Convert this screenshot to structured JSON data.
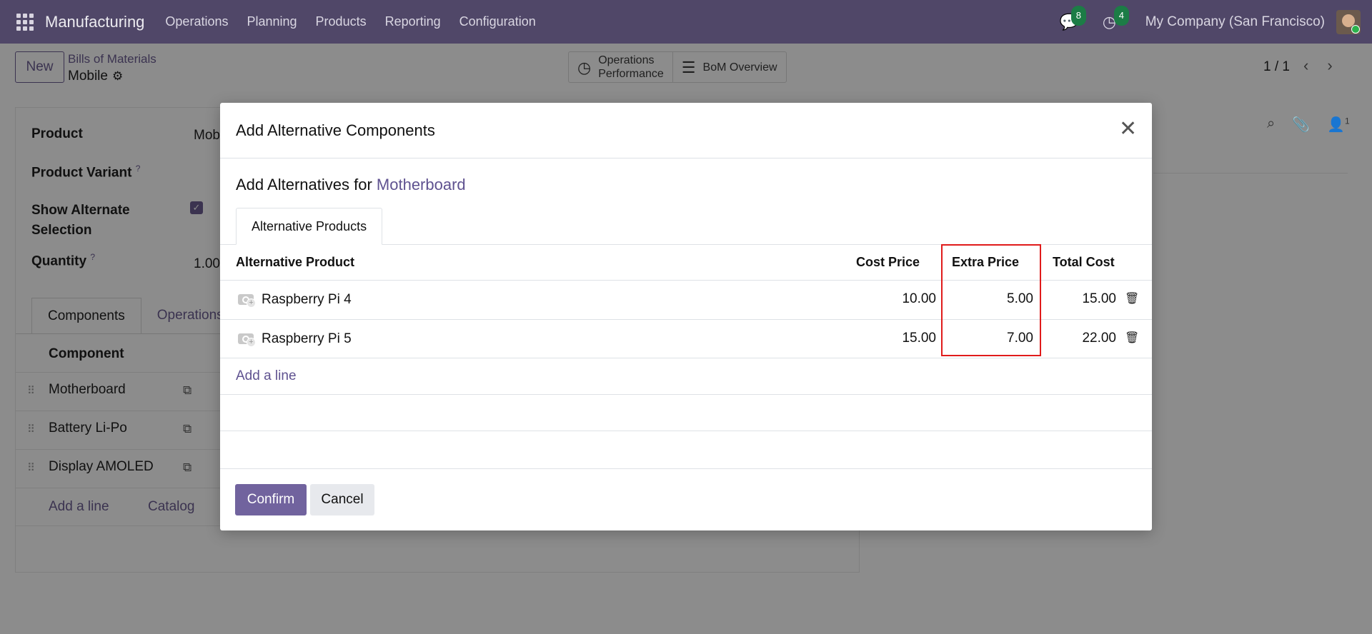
{
  "navbar": {
    "app_name": "Manufacturing",
    "menu": [
      "Operations",
      "Planning",
      "Products",
      "Reporting",
      "Configuration"
    ],
    "messages_count": "8",
    "activities_count": "4",
    "company": "My Company (San Francisco)"
  },
  "control_panel": {
    "new_label": "New",
    "breadcrumb_parent": "Bills of Materials",
    "record_name": "Mobile",
    "smart_buttons": {
      "ops_line1": "Operations",
      "ops_line2": "Performance",
      "bom_overview": "BoM Overview"
    },
    "pager": "1 / 1"
  },
  "form": {
    "product_label": "Product",
    "product_value": "Mob",
    "variant_label": "Product Variant",
    "variant_help": "?",
    "alternate_label_1": "Show Alternate",
    "alternate_label_2": "Selection",
    "alternate_checked": true,
    "quantity_label": "Quantity",
    "quantity_help": "?",
    "quantity_value": "1.00",
    "tabs": [
      "Components",
      "Operations"
    ],
    "component_header": "Component",
    "components": [
      "Motherboard",
      "Battery Li-Po",
      "Display AMOLED"
    ],
    "add_line": "Add a line",
    "catalog": "Catalog",
    "follower_count": "1"
  },
  "modal": {
    "title": "Add Alternative Components",
    "subtitle_prefix": "Add Alternatives for",
    "subtitle_product": "Motherboard",
    "tab": "Alternative Products",
    "columns": {
      "product": "Alternative Product",
      "cost": "Cost Price",
      "extra": "Extra Price",
      "total": "Total Cost"
    },
    "rows": [
      {
        "product": "Raspberry Pi 4",
        "cost": "10.00",
        "extra": "5.00",
        "total": "15.00"
      },
      {
        "product": "Raspberry Pi 5",
        "cost": "15.00",
        "extra": "7.00",
        "total": "22.00"
      }
    ],
    "add_line": "Add a line",
    "confirm": "Confirm",
    "cancel": "Cancel",
    "highlight_color": "#e01b1b",
    "accent_color": "#71639e"
  }
}
